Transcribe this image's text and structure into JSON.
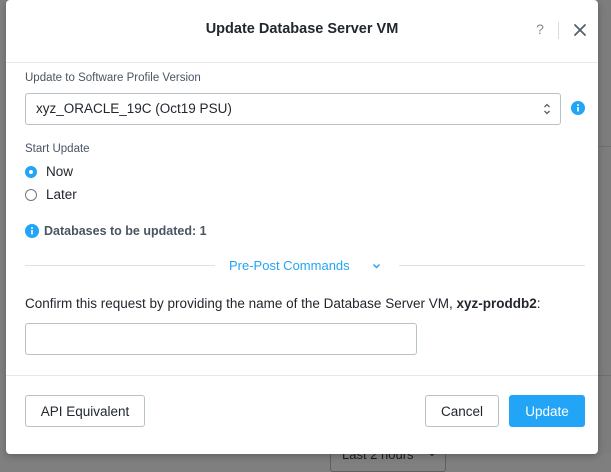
{
  "modal": {
    "title": "Update Database Server VM",
    "help_glyph": "?",
    "help_icon": "question-mark-icon",
    "close_icon": "close-x-icon"
  },
  "software_profile": {
    "label": "Update to Software Profile Version",
    "selected": "xyz_ORACLE_19C (Oct19 PSU)",
    "info_icon": "info-icon"
  },
  "start_update": {
    "label": "Start Update",
    "options": [
      {
        "label": "Now",
        "checked": true
      },
      {
        "label": "Later",
        "checked": false
      }
    ]
  },
  "databases_info": {
    "text": "Databases to be updated: 1",
    "icon": "info-icon"
  },
  "pre_post": {
    "label": "Pre-Post Commands",
    "icon": "chevron-down-icon"
  },
  "confirm": {
    "text_prefix": "Confirm this request by providing the name of the Database Server VM, ",
    "vm_name": "xyz-proddb2",
    "text_suffix": ":",
    "input_value": "",
    "input_placeholder": ""
  },
  "footer": {
    "api_button": "API Equivalent",
    "cancel_button": "Cancel",
    "update_button": "Update"
  },
  "background": {
    "dropdown_label": "Last 2 hours",
    "dropdown_icon": "chevron-down-icon"
  },
  "colors": {
    "accent": "#22a5f7",
    "overlay": "#808080"
  }
}
